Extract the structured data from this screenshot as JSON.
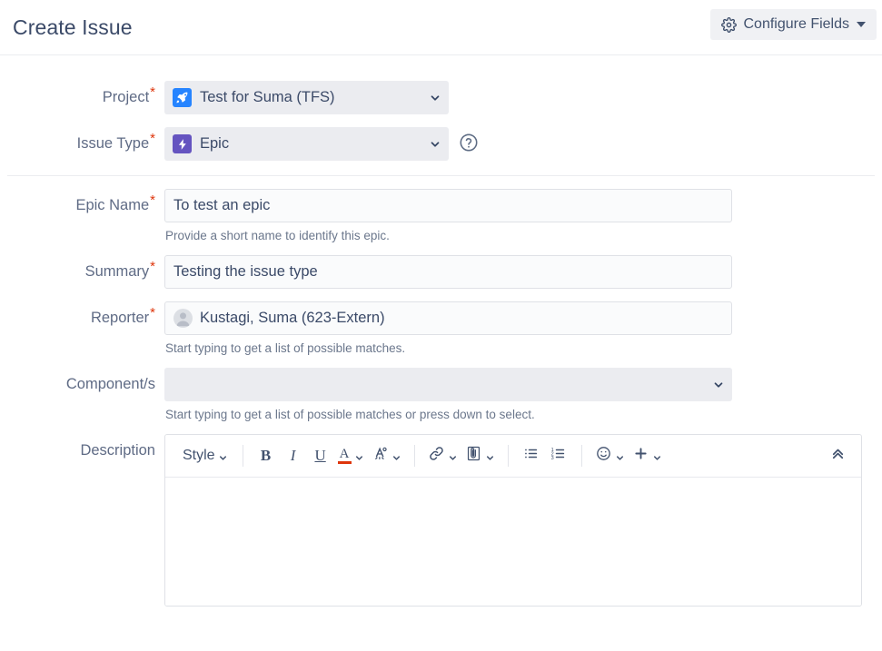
{
  "header": {
    "title": "Create Issue",
    "configure_fields_label": "Configure Fields",
    "gear_icon": "gear-icon",
    "caret_icon": "chevron-down-icon"
  },
  "form": {
    "project": {
      "label": "Project",
      "required": true,
      "value": "Test for Suma (TFS)",
      "icon": "project-avatar-icon",
      "icon_color": "#2684ff"
    },
    "issue_type": {
      "label": "Issue Type",
      "required": true,
      "value": "Epic",
      "icon": "epic-icon",
      "icon_color": "#6554c0",
      "help_icon": "question-circle-icon"
    },
    "epic_name": {
      "label": "Epic Name",
      "required": true,
      "value": "To test an epic",
      "placeholder": "",
      "hint": "Provide a short name to identify this epic."
    },
    "summary": {
      "label": "Summary",
      "required": true,
      "value": "Testing the issue type",
      "placeholder": "",
      "hint": ""
    },
    "reporter": {
      "label": "Reporter",
      "required": true,
      "value": "Kustagi, Suma (623-Extern)",
      "placeholder": "",
      "avatar_icon": "user-avatar-icon",
      "hint": "Start typing to get a list of possible matches."
    },
    "components": {
      "label": "Component/s",
      "required": false,
      "value": "",
      "hint": "Start typing to get a list of possible matches or press down to select."
    },
    "description": {
      "label": "Description",
      "required": false,
      "value": "",
      "toolbar": {
        "style_label": "Style",
        "bold_label": "B",
        "italic_label": "I",
        "underline_label": "U",
        "text_color_label": "A",
        "text_color_swatch": "#de350b",
        "highlight_color_label": "A",
        "link_icon": "link-icon",
        "attachment_icon": "paperclip-icon",
        "bullet_list_icon": "bullet-list-icon",
        "numbered_list_icon": "numbered-list-icon",
        "emoji_icon": "emoji-icon",
        "insert_icon": "plus-icon",
        "collapse_icon": "double-chevron-up-icon"
      }
    }
  },
  "colors": {
    "text_dark": "#3b4a68",
    "label": "#5f6b85",
    "hint": "#6b778c",
    "required_star": "#de350b",
    "field_gray": "#ebecf0",
    "input_bg": "#fafbfc",
    "border": "#dfe1e6"
  }
}
